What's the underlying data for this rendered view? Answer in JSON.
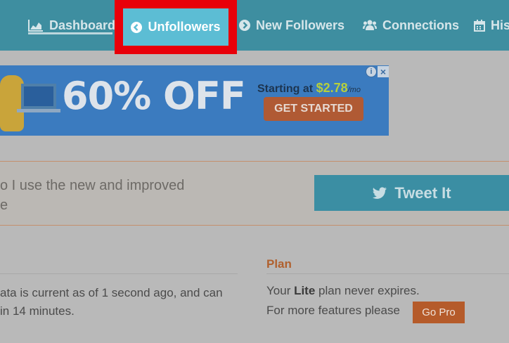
{
  "nav": {
    "dashboard_label": "Dashboard",
    "unfollowers_label": "Unfollowers",
    "new_followers_label": "New Followers",
    "connections_label": "Connections",
    "history_label": "His",
    "highlight_color": "#e8000a",
    "bar_color": "#3e8ea0",
    "active_color": "#5cbdd4",
    "icons": [
      "chart-icon",
      "arrow-left-circle-icon",
      "arrow-right-circle-icon",
      "users-icon",
      "calendar-icon"
    ]
  },
  "ad": {
    "headline": "60% OFF",
    "starting_text": "Starting at ",
    "price": "$2.78",
    "per_month": "/mo",
    "cta_label": "GET STARTED",
    "info_glyph": "i",
    "close_glyph": "×"
  },
  "banner": {
    "line1": "o I use the new and improved",
    "line2": "e",
    "tweet_label": "Tweet It"
  },
  "status": {
    "line1": "ata is current as of 1 second ago, and can",
    "line2": "in 14 minutes."
  },
  "plan": {
    "title": "Plan",
    "line1_prefix": "Your ",
    "plan_name": "Lite",
    "line1_suffix": " plan never expires.",
    "line2": "For more features please",
    "gopro_label": "Go Pro"
  }
}
